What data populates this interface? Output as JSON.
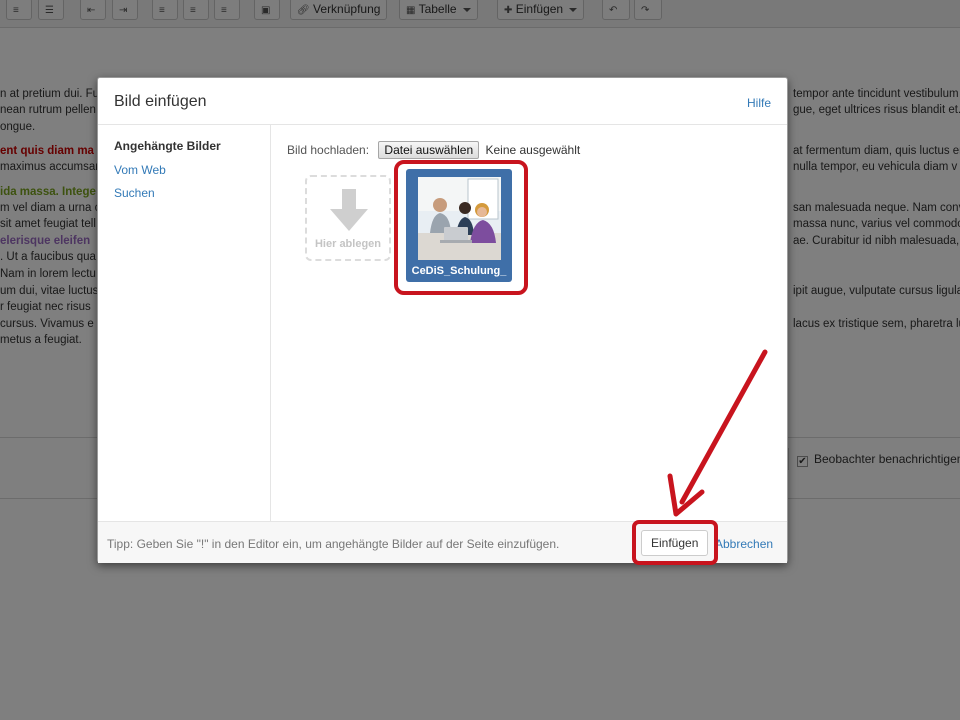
{
  "toolbar": {
    "link_label": "Verknüpfung",
    "table_label": "Tabelle",
    "insert_label": "Einfügen"
  },
  "background": {
    "lines": [
      {
        "a": "n at pretium dui. Fu",
        "b": "tempor ante tincidunt vestibulum n"
      },
      {
        "a": "nean rutrum pellen",
        "b": "gue, eget ultrices risus blandit et."
      },
      {
        "a": "ongue.",
        "b": ""
      },
      {
        "a": "ent quis diam ma",
        "b": "at fermentum diam, quis luctus er"
      },
      {
        "a": "maximus accumsan",
        "b": "nulla tempor, eu vehicula diam v"
      },
      {
        "a": "ida massa. Intege",
        "b": ""
      },
      {
        "a": "m vel diam a urna c",
        "b": "san malesuada neque. Nam conv"
      },
      {
        "a": "sit amet feugiat tell",
        "b": "massa nunc, varius vel commodo v"
      },
      {
        "a": "elerisque eleifen",
        "b": "ae. Curabitur id nibh malesuada,"
      },
      {
        "a": ". Ut a faucibus qua",
        "b": ""
      },
      {
        "a": "Nam in lorem lectu",
        "b": ""
      },
      {
        "a": "um dui, vitae luctus",
        "b": "ipit augue, vulputate cursus ligula"
      },
      {
        "a": "r feugiat nec risus",
        "b": ""
      },
      {
        "a": "cursus. Vivamus e",
        "b": "lacus ex tristique sem, pharetra lu"
      },
      {
        "a": "metus a feugiat.",
        "b": ""
      }
    ],
    "watchers_label": "Beobachter benachrichtigen"
  },
  "dialog": {
    "title": "Bild einfügen",
    "help": "Hilfe",
    "sidebar": [
      {
        "label": "Angehängte Bilder"
      },
      {
        "label": "Vom Web"
      },
      {
        "label": "Suchen"
      }
    ],
    "upload_label": "Bild hochladen:",
    "choose_file": "Datei auswählen",
    "no_file": "Keine ausgewählt",
    "drop_label": "Hier ablegen",
    "thumbnail_name": "CeDiS_Schulung_",
    "tip": "Tipp: Geben Sie \"!\" in den Editor ein, um angehängte Bilder auf der Seite einzufügen.",
    "insert": "Einfügen",
    "cancel": "Abbrechen"
  },
  "colors": {
    "accent": "#337ab7",
    "annotation": "#c8141e",
    "thumb_bg": "#3f6fa8"
  }
}
